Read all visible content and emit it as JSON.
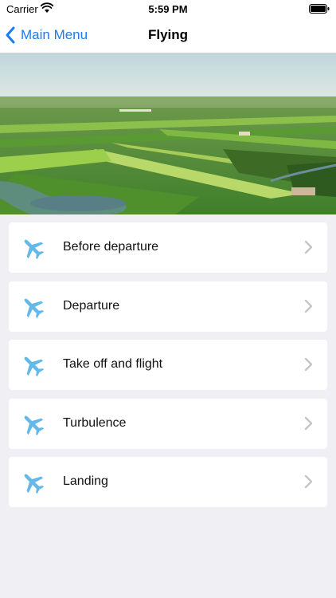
{
  "status_bar": {
    "carrier": "Carrier",
    "time": "5:59 PM",
    "wifi_icon": "wifi-icon",
    "battery_icon": "battery-icon"
  },
  "nav": {
    "back_label": "Main Menu",
    "back_icon": "chevron-left-icon",
    "title": "Flying",
    "accent_color": "#1a7cf0"
  },
  "hero": {
    "image_description": "aerial-farmland-photo"
  },
  "menu": {
    "icon": "airplane-icon",
    "icon_color": "#64b9e8",
    "chevron_icon": "chevron-right-icon",
    "items": [
      {
        "label": "Before departure"
      },
      {
        "label": "Departure"
      },
      {
        "label": "Take off and flight"
      },
      {
        "label": "Turbulence"
      },
      {
        "label": "Landing"
      }
    ]
  }
}
